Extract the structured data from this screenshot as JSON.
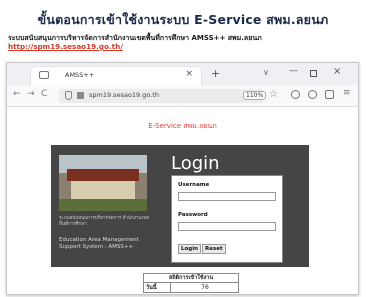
{
  "slide": {
    "title": "ขั้นตอนการเข้าใช้งานระบบ E-Service สพม.ลยนภ",
    "subtitle": "ระบบสนับสนุนการบริหารจัดการสำนักงานเขตพื้นที่การศึกษา AMSS++ สพม.ลยนภ",
    "link": "http://spm19.sesao19.go.th/"
  },
  "browser": {
    "tab_title": "AMSS++",
    "url": "spm19.sesao19.go.th",
    "zoom": "110%"
  },
  "page": {
    "eservice_title": "E-Service สพม.ลยนภ",
    "login": {
      "heading": "Login",
      "username_label": "Username",
      "password_label": "Password",
      "login_button": "Login",
      "reset_button": "Reset"
    },
    "org": {
      "thai_text": "ระบบสนับสนุนการบริหารจัดการ สำนักงานเขตพื้นที่การศึกษา",
      "english_text": "Education Area Management Support System : AMSS++"
    },
    "stats": {
      "title": "สถิติการเข้าใช้งาน",
      "rows": [
        {
          "label": "วันนี้",
          "value": "76"
        }
      ]
    }
  }
}
